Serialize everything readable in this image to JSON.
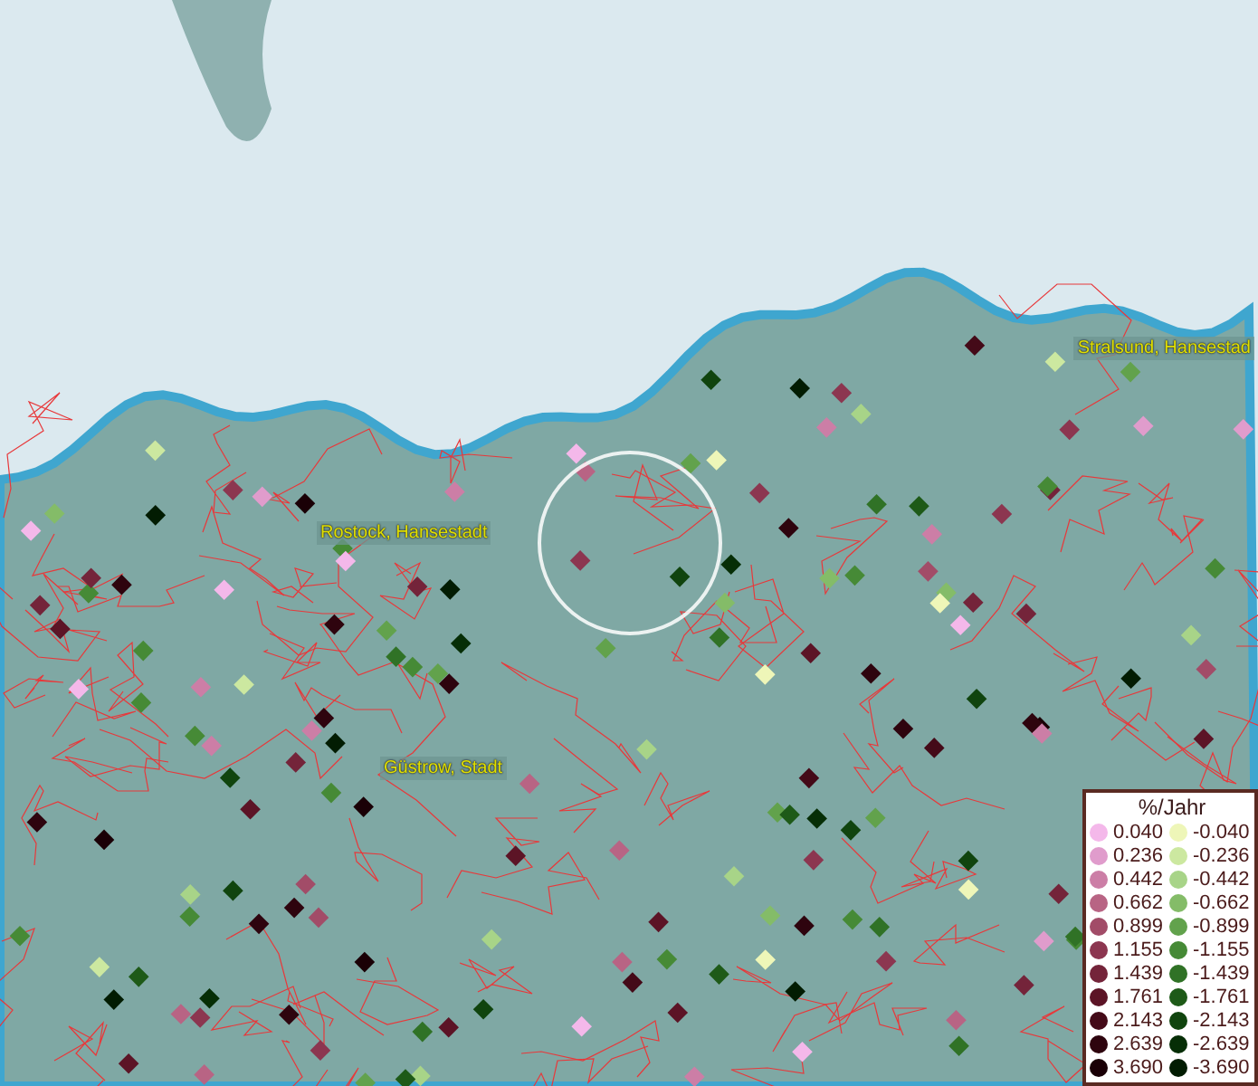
{
  "map": {
    "places": [
      {
        "name": "Rostock, Hansestadt"
      },
      {
        "name": "Güstrow, Stadt"
      },
      {
        "name": "Stralsund, Hansestad"
      }
    ]
  },
  "legend": {
    "title": "%/Jahr",
    "positive": [
      {
        "label": "0.040",
        "color": "#f4b8ea"
      },
      {
        "label": "0.236",
        "color": "#e09ccc"
      },
      {
        "label": "0.442",
        "color": "#cc7ea6"
      },
      {
        "label": "0.662",
        "color": "#b86484"
      },
      {
        "label": "0.899",
        "color": "#a24c68"
      },
      {
        "label": "1.155",
        "color": "#8c3650"
      },
      {
        "label": "1.439",
        "color": "#74243a"
      },
      {
        "label": "1.761",
        "color": "#5c1426"
      },
      {
        "label": "2.143",
        "color": "#440a18"
      },
      {
        "label": "2.639",
        "color": "#2e040e"
      },
      {
        "label": "3.690",
        "color": "#1a0006"
      }
    ],
    "negative": [
      {
        "label": "-0.040",
        "color": "#eef6b8"
      },
      {
        "label": "-0.236",
        "color": "#cce8a0"
      },
      {
        "label": "-0.442",
        "color": "#a8d488"
      },
      {
        "label": "-0.662",
        "color": "#84bc68"
      },
      {
        "label": "-0.899",
        "color": "#62a24c"
      },
      {
        "label": "-1.155",
        "color": "#468a36"
      },
      {
        "label": "-1.439",
        "color": "#307226"
      },
      {
        "label": "-1.761",
        "color": "#1e5a18"
      },
      {
        "label": "-2.143",
        "color": "#10440e"
      },
      {
        "label": "-2.639",
        "color": "#062e06"
      },
      {
        "label": "-3.690",
        "color": "#021c02"
      }
    ]
  }
}
